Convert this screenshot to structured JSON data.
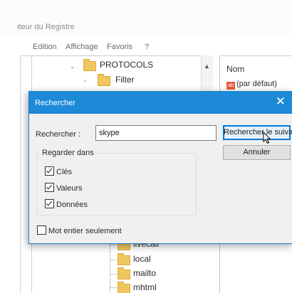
{
  "window": {
    "title": "iteur du Registre",
    "menu": [
      "Edition",
      "Affichage",
      "Favoris",
      "?"
    ]
  },
  "tree": {
    "protocols_label": "PROTOCOLS",
    "filter_label": "Filter",
    "items_below": [
      "livecall",
      "local",
      "mailto",
      "mhtml"
    ]
  },
  "list": {
    "column_name": "Nom",
    "default_value": "(par défaut)",
    "default_icon": "ab"
  },
  "dialog": {
    "title": "Rechercher",
    "search_label": "Rechercher :",
    "search_value": "skype",
    "find_next_label": "Rechercher le suivant",
    "cancel_label": "Annuler",
    "group_label": "Regarder dans",
    "options": [
      {
        "label": "Clés",
        "checked": true
      },
      {
        "label": "Valeurs",
        "checked": true
      },
      {
        "label": "Données",
        "checked": true
      }
    ],
    "whole_string_label": "Mot entier seulement",
    "whole_string_checked": false
  },
  "colors": {
    "dialog_title_bg": "#1d8ad8",
    "folder": "#f0c75e",
    "primary_button_border": "#0078d7"
  }
}
